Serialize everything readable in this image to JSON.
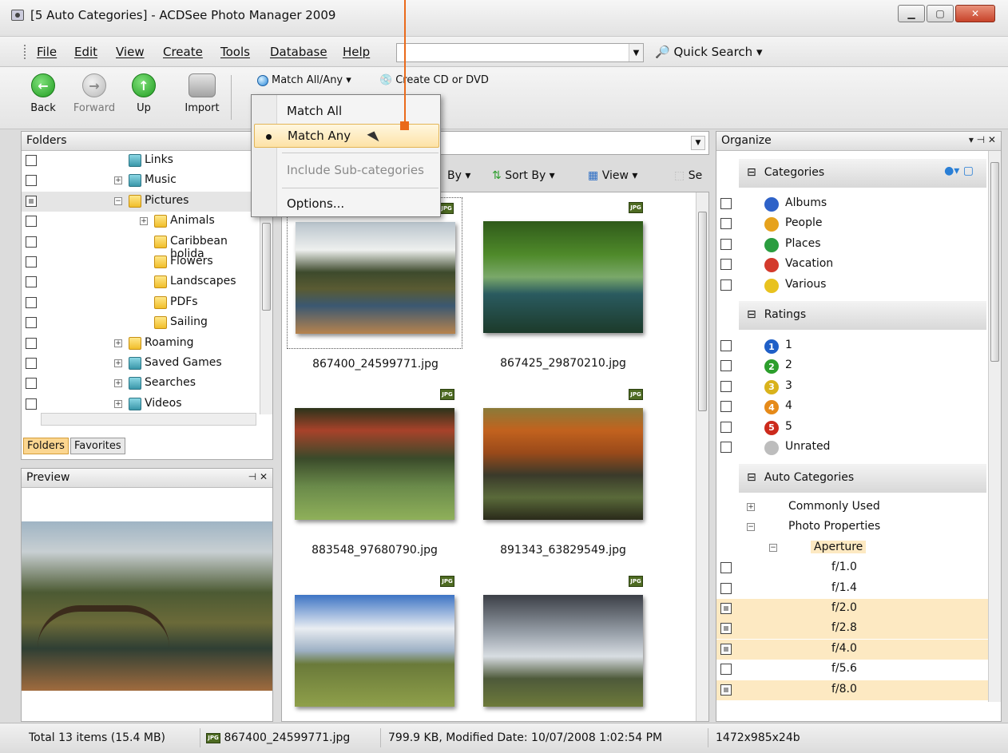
{
  "window": {
    "title": "[5 Auto Categories] - ACDSee Photo Manager 2009"
  },
  "menu": [
    "File",
    "Edit",
    "View",
    "Create",
    "Tools",
    "Database",
    "Help"
  ],
  "quick_search": "Quick Search ▾",
  "toolbar": {
    "back": "Back",
    "forward": "Forward",
    "up": "Up",
    "import": "Import",
    "match": "Match All/Any ▾",
    "create_cd": "Create CD or DVD"
  },
  "dropdown": {
    "items": [
      {
        "label": "Match All"
      },
      {
        "label": "Match Any"
      },
      {
        "label": "Include Sub-categories"
      },
      {
        "label": "Options..."
      }
    ]
  },
  "folders": {
    "title": "Folders",
    "items": [
      {
        "label": "Links",
        "indent": 1,
        "expander": "",
        "teal": true
      },
      {
        "label": "Music",
        "indent": 1,
        "expander": "+",
        "teal": true
      },
      {
        "label": "Pictures",
        "indent": 1,
        "expander": "−",
        "sel": true
      },
      {
        "label": "Animals",
        "indent": 2,
        "expander": "+"
      },
      {
        "label": "Caribbean holida",
        "indent": 2,
        "expander": ""
      },
      {
        "label": "Flowers",
        "indent": 2,
        "expander": ""
      },
      {
        "label": "Landscapes",
        "indent": 2,
        "expander": ""
      },
      {
        "label": "PDFs",
        "indent": 2,
        "expander": ""
      },
      {
        "label": "Sailing",
        "indent": 2,
        "expander": ""
      },
      {
        "label": "Roaming",
        "indent": 1,
        "expander": "+"
      },
      {
        "label": "Saved Games",
        "indent": 1,
        "expander": "+",
        "teal": true
      },
      {
        "label": "Searches",
        "indent": 1,
        "expander": "+",
        "teal": true
      },
      {
        "label": "Videos",
        "indent": 1,
        "expander": "+",
        "teal": true
      }
    ],
    "tabs": [
      "Folders",
      "Favorites"
    ]
  },
  "preview": {
    "title": "Preview"
  },
  "filebar": {
    "group": "By ▾",
    "sort": "Sort By ▾",
    "view": "View ▾",
    "se": "Se"
  },
  "thumbnails": [
    {
      "name": "867400_24599771.jpg"
    },
    {
      "name": "867425_29870210.jpg"
    },
    {
      "name": "883548_97680790.jpg"
    },
    {
      "name": "891343_63829549.jpg"
    },
    {
      "name": ""
    },
    {
      "name": ""
    }
  ],
  "organize": {
    "title": "Organize",
    "categories_label": "Categories",
    "categories": [
      {
        "label": "Albums",
        "color": "#2e62c8"
      },
      {
        "label": "People",
        "color": "#e6a21d"
      },
      {
        "label": "Places",
        "color": "#2a9d3f"
      },
      {
        "label": "Vacation",
        "color": "#d33a2c"
      },
      {
        "label": "Various",
        "color": "#e8c21f"
      }
    ],
    "ratings_label": "Ratings",
    "ratings": [
      {
        "label": "1",
        "num": "1",
        "color": "#1f5fc7"
      },
      {
        "label": "2",
        "num": "2",
        "color": "#2c9e2c"
      },
      {
        "label": "3",
        "num": "3",
        "color": "#d9b21b"
      },
      {
        "label": "4",
        "num": "4",
        "color": "#e58a19"
      },
      {
        "label": "5",
        "num": "5",
        "color": "#cc2a1c"
      },
      {
        "label": "Unrated",
        "num": "",
        "color": "#bdbdbd"
      }
    ],
    "auto_label": "Auto Categories",
    "auto": [
      {
        "label": "Commonly Used",
        "level": 0,
        "exp": "+"
      },
      {
        "label": "Photo Properties",
        "level": 0,
        "exp": "−"
      },
      {
        "label": "Aperture",
        "level": 1,
        "exp": "−",
        "hl": true
      },
      {
        "label": "f/1.0",
        "level": 2,
        "cb": "empty"
      },
      {
        "label": "f/1.4",
        "level": 2,
        "cb": "empty"
      },
      {
        "label": "f/2.0",
        "level": 2,
        "cb": "partial",
        "hl": true
      },
      {
        "label": "f/2.8",
        "level": 2,
        "cb": "partial",
        "hl": true
      },
      {
        "label": "f/4.0",
        "level": 2,
        "cb": "partial",
        "hl": true
      },
      {
        "label": "f/5.6",
        "level": 2,
        "cb": "empty"
      },
      {
        "label": "f/8.0",
        "level": 2,
        "cb": "partial",
        "hl": true
      }
    ]
  },
  "status": {
    "total": "Total 13 items (15.4 MB)",
    "file": "867400_24599771.jpg",
    "info": "799.9 KB, Modified Date: 10/07/2008 1:02:54 PM",
    "dims": "1472x985x24b"
  }
}
